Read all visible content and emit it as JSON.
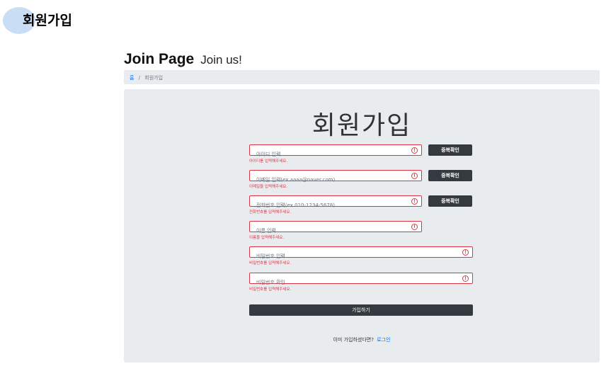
{
  "header": {
    "title": "회원가입"
  },
  "heading": {
    "main": "Join Page",
    "sub": "Join us!"
  },
  "breadcrumb": {
    "home": "홈",
    "separator": "/",
    "current": "회원가입"
  },
  "form": {
    "title": "회원가입",
    "id": {
      "placeholder": "아이디 입력",
      "feedback": "아이디를 입력해주세요.",
      "check_label": "중복확인"
    },
    "email": {
      "placeholder": "이메일 입력(ex aaaa@naver.com)",
      "feedback": "이메일을 입력해주세요.",
      "check_label": "중복확인"
    },
    "phone": {
      "placeholder": "전화번호 입력(ex 010-1234-5678)",
      "feedback": "전화번호를 입력해주세요.",
      "check_label": "중복확인"
    },
    "name": {
      "placeholder": "이름 입력",
      "feedback": "이름을 입력해주세요."
    },
    "password": {
      "placeholder": "비밀번호 입력",
      "feedback": "비밀번호를 입력해주세요."
    },
    "password_confirm": {
      "placeholder": "비밀번호 확인",
      "feedback": "비밀번호를 입력해주세요."
    },
    "error_icon": "!",
    "submit_label": "가입하기",
    "login_prompt": "이미 가입하셨다면?",
    "login_link": "로그인"
  },
  "colors": {
    "error": "#dc3545",
    "button": "#343a40",
    "panel": "#e9ecef",
    "link": "#0d6efd",
    "accent_circle": "#c9ddf4"
  },
  "icons": {
    "field_error": "exclamation-circle-icon"
  }
}
